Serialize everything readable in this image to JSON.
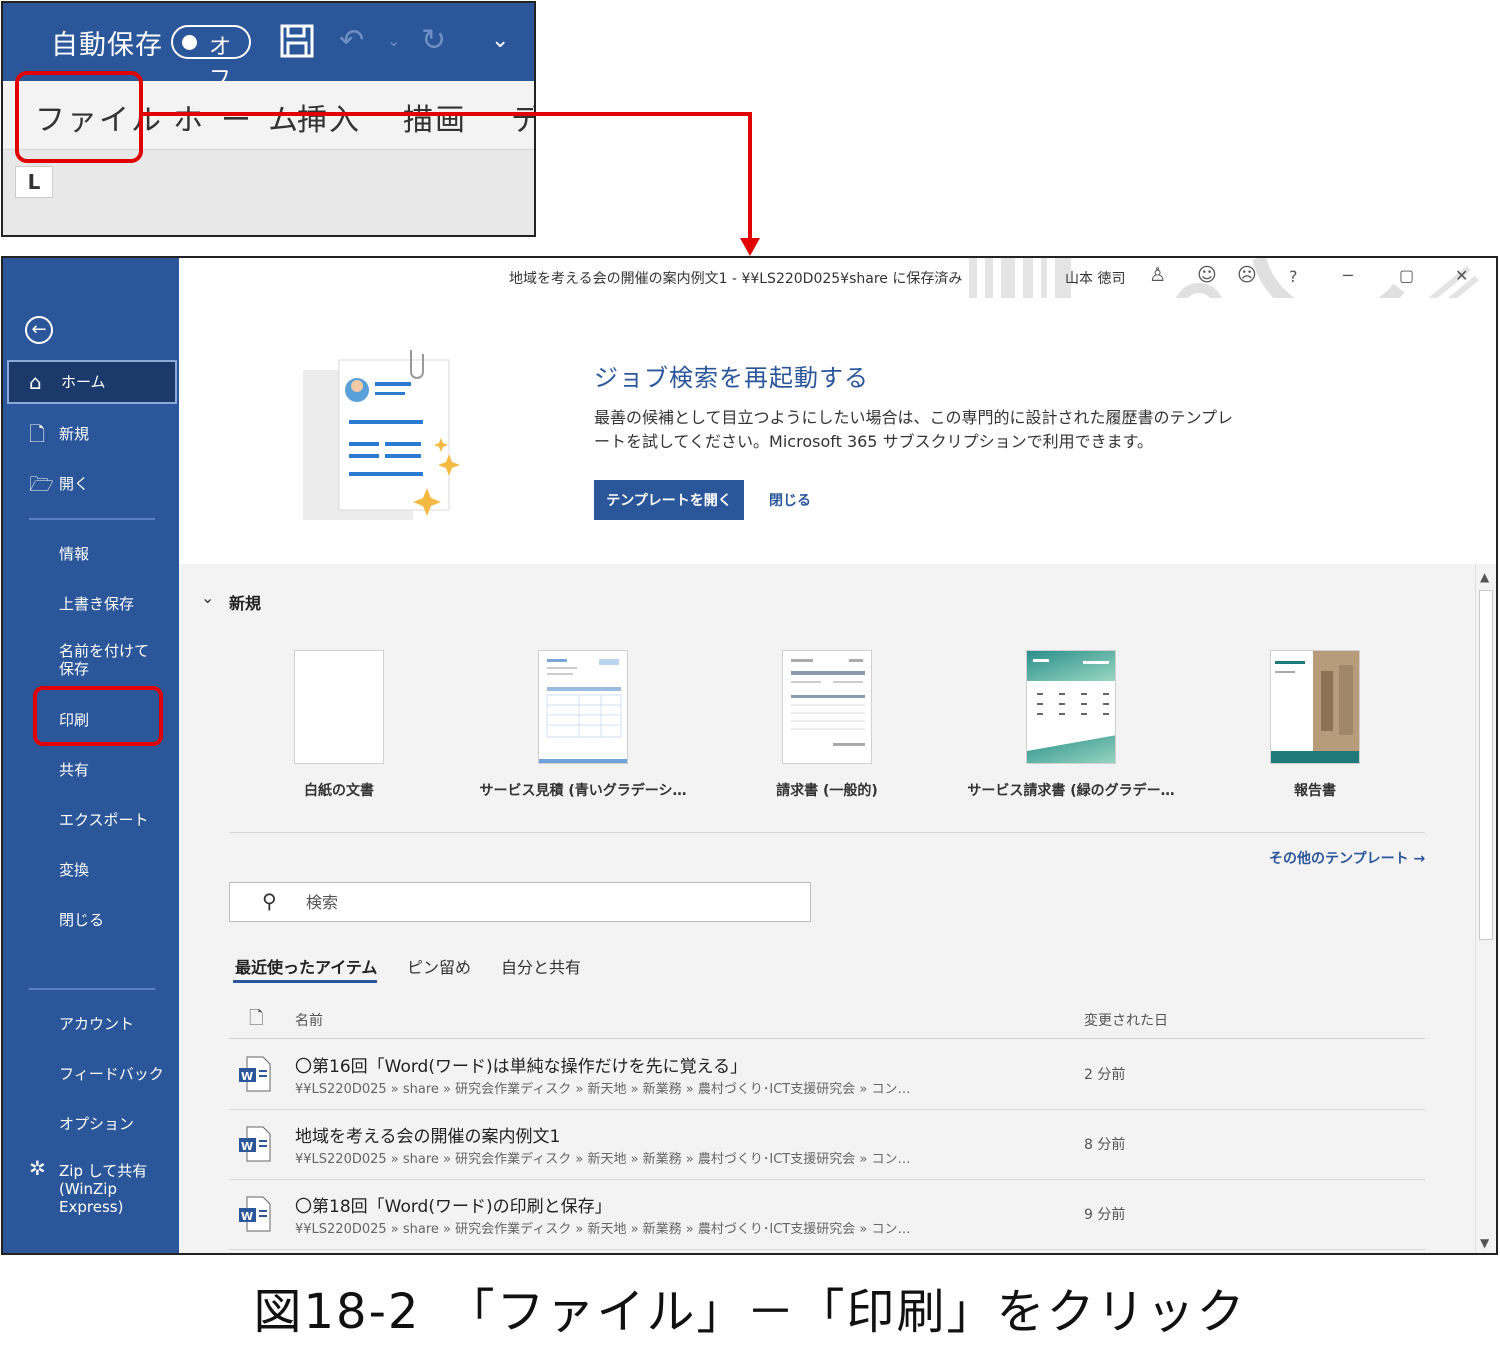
{
  "qat": {
    "autosave_label": "自動保存",
    "autosave_state": "オフ",
    "icons": [
      "save-icon",
      "undo-icon",
      "undo-dropdown-icon",
      "redo-icon",
      "customize-qat-icon"
    ]
  },
  "ribbon": {
    "tabs": [
      "ファイル",
      "ホーム",
      "挿入",
      "描画",
      "デ"
    ]
  },
  "window": {
    "title": "地域を考える会の開催の案内例文1 - ¥¥LS220D025¥share に保存済み",
    "user": "山本 徳司",
    "buttons": [
      "?",
      "─",
      "▢",
      "✕"
    ]
  },
  "sidebar": {
    "items": [
      "ホーム",
      "新規",
      "開く",
      "情報",
      "上書き保存",
      "名前を付けて保存",
      "印刷",
      "共有",
      "エクスポート",
      "変換",
      "閉じる",
      "アカウント",
      "フィードバック",
      "オプション",
      "Zip して共有 (WinZip Express)"
    ]
  },
  "banner": {
    "title": "ジョブ検索を再起動する",
    "text": "最善の候補として目立つようにしたい場合は、この専門的に設計された履歴書のテンプレートを試してください。Microsoft 365 サブスクリプションで利用できます。",
    "open_button": "テンプレートを開く",
    "close_link": "閉じる"
  },
  "new_section": {
    "title": "新規",
    "templates": [
      "白紙の文書",
      "サービス見積 (青いグラデーシ…",
      "請求書 (一般的)",
      "サービス請求書 (緑のグラデー…",
      "報告書"
    ],
    "more_link": "その他のテンプレート →"
  },
  "search": {
    "placeholder": "検索"
  },
  "recent": {
    "tabs": [
      "最近使ったアイテム",
      "ピン留め",
      "自分と共有"
    ],
    "col_name": "名前",
    "col_modified": "変更された日",
    "rows": [
      {
        "name": "〇第16回「Word(ワード)は単純な操作だけを先に覚える」",
        "path": "¥¥LS220D025 » share » 研究会作業ディスク » 新天地 » 新業務 » 農村づくり･ICT支援研究会 » コン…",
        "time": "2 分前"
      },
      {
        "name": "地域を考える会の開催の案内例文1",
        "path": "¥¥LS220D025 » share » 研究会作業ディスク » 新天地 » 新業務 » 農村づくり･ICT支援研究会 » コン…",
        "time": "8 分前"
      },
      {
        "name": "〇第18回「Word(ワード)の印刷と保存」",
        "path": "¥¥LS220D025 » share » 研究会作業ディスク » 新天地 » 新業務 » 農村づくり･ICT支援研究会 » コン…",
        "time": "9 分前"
      }
    ]
  },
  "caption": "図18-2　「ファイル」－「印刷」をクリック",
  "colors": {
    "accent": "#2b579a",
    "highlight": "#e00000"
  }
}
